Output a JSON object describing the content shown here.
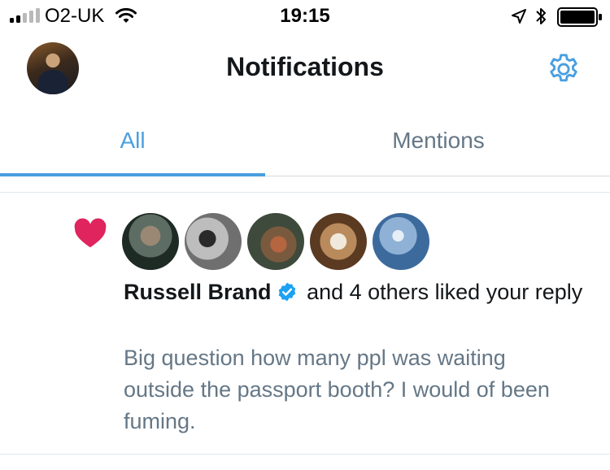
{
  "status_bar": {
    "carrier": "O2-UK",
    "time": "19:15"
  },
  "header": {
    "title": "Notifications"
  },
  "tabs": [
    {
      "label": "All",
      "active": true
    },
    {
      "label": "Mentions",
      "active": false
    }
  ],
  "notification": {
    "type_icon": "heart-icon",
    "user_name": "Russell Brand",
    "verified": true,
    "action_text": " and 4 others liked your reply",
    "tweet_text": "Big question how many ppl was waiting outside the passport booth? I would of been fuming."
  },
  "colors": {
    "accent": "#4a9fe0",
    "heart": "#e0245e",
    "muted": "#657786",
    "verified": "#1da1f2"
  }
}
